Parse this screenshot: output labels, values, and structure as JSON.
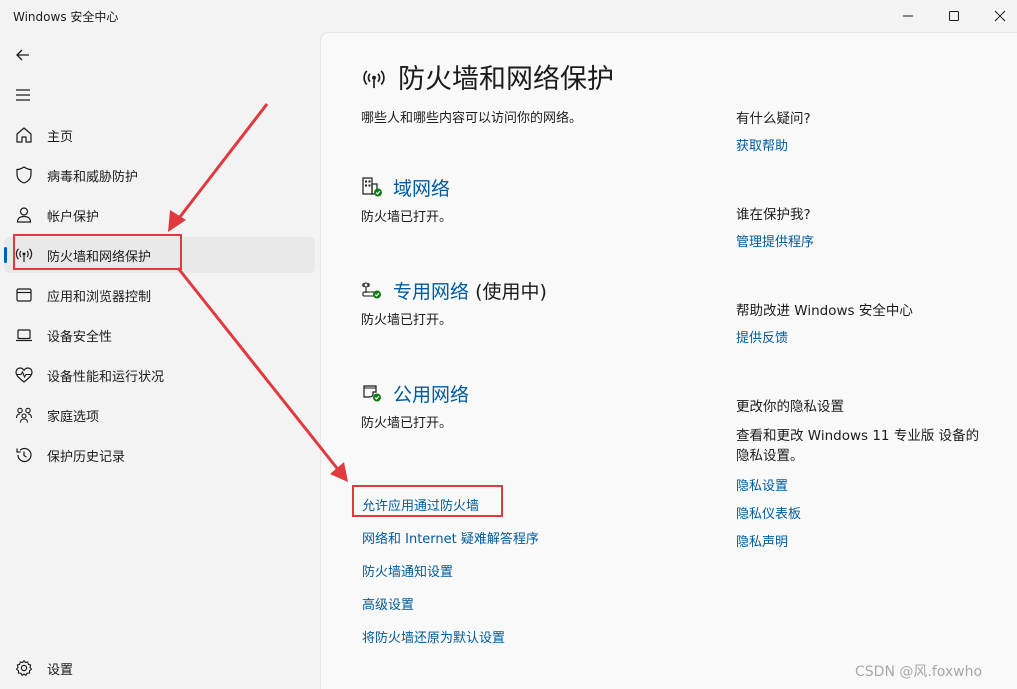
{
  "window": {
    "title": "Windows 安全中心"
  },
  "sidebar": {
    "back_icon": "back-arrow-icon",
    "menu_icon": "hamburger-menu-icon",
    "items": [
      {
        "label": "主页",
        "icon": "home-icon"
      },
      {
        "label": "病毒和威胁防护",
        "icon": "shield-icon"
      },
      {
        "label": "帐户保护",
        "icon": "person-icon"
      },
      {
        "label": "防火墙和网络保护",
        "icon": "antenna-icon",
        "selected": true
      },
      {
        "label": "应用和浏览器控制",
        "icon": "app-window-icon"
      },
      {
        "label": "设备安全性",
        "icon": "laptop-icon"
      },
      {
        "label": "设备性能和运行状况",
        "icon": "heart-pulse-icon"
      },
      {
        "label": "家庭选项",
        "icon": "family-icon"
      },
      {
        "label": "保护历史记录",
        "icon": "history-icon"
      }
    ],
    "settings_label": "设置"
  },
  "main": {
    "title": "防火墙和网络保护",
    "subtitle": "哪些人和哪些内容可以访问你的网络。",
    "networks": [
      {
        "name": "域网络",
        "in_use": "",
        "status": "防火墙已打开。",
        "icon": "domain-network-icon"
      },
      {
        "name": "专用网络",
        "in_use": "(使用中)",
        "status": "防火墙已打开。",
        "icon": "private-network-icon"
      },
      {
        "name": "公用网络",
        "in_use": "",
        "status": "防火墙已打开。",
        "icon": "public-network-icon"
      }
    ],
    "links": [
      "允许应用通过防火墙",
      "网络和 Internet 疑难解答程序",
      "防火墙通知设置",
      "高级设置",
      "将防火墙还原为默认设置"
    ]
  },
  "aside": {
    "help": {
      "heading": "有什么疑问?",
      "link": "获取帮助"
    },
    "protect": {
      "heading": "谁在保护我?",
      "link": "管理提供程序"
    },
    "improve": {
      "heading": "帮助改进 Windows 安全中心",
      "link": "提供反馈"
    },
    "privacy": {
      "heading": "更改你的隐私设置",
      "text": "查看和更改 Windows 11 专业版 设备的隐私设置。",
      "links": [
        "隐私设置",
        "隐私仪表板",
        "隐私声明"
      ]
    }
  },
  "watermark": "CSDN @风.foxwho",
  "colors": {
    "accent": "#005fb8",
    "link": "#005a9e",
    "annotation": "#e0393e",
    "status_ok": "#107c10"
  }
}
